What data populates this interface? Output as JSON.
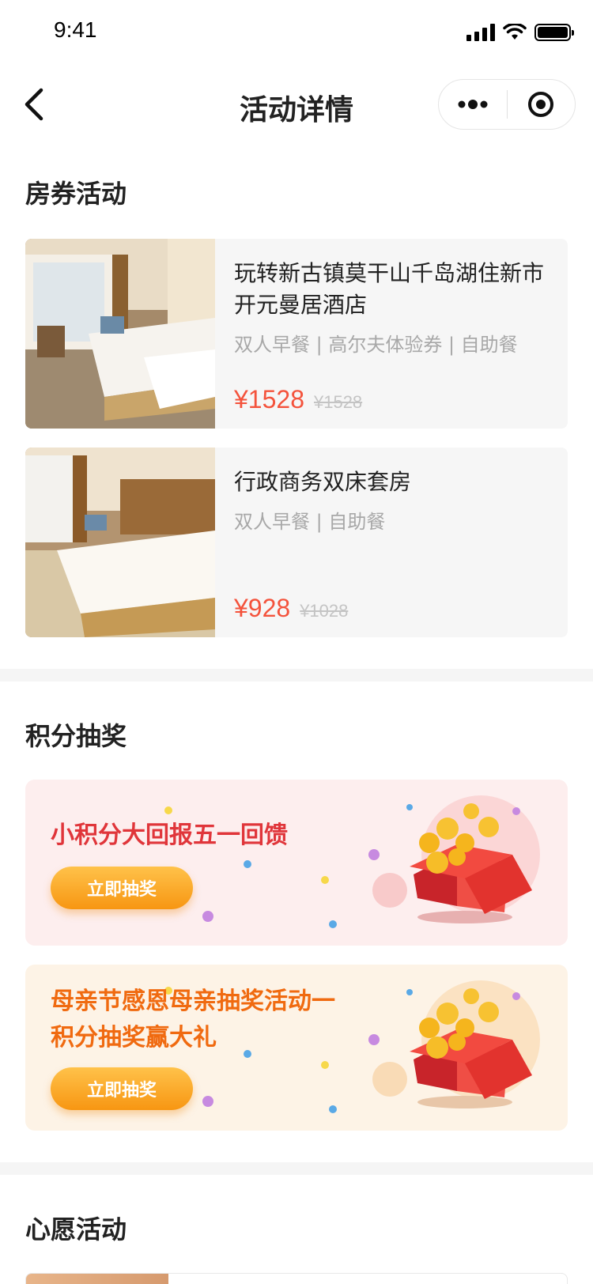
{
  "status_bar": {
    "time": "9:41"
  },
  "nav": {
    "title": "活动详情"
  },
  "sections": {
    "room_title": "房券活动",
    "points_title": "积分抽奖",
    "wish_title": "心愿活动"
  },
  "rooms": [
    {
      "name": "玩转新古镇莫干山千岛湖住新市开元曼居酒店",
      "tags": "双人早餐 | 高尔夫体验券 | 自助餐",
      "price": "¥1528",
      "original_price": "¥1528"
    },
    {
      "name": "行政商务双床套房",
      "tags": "双人早餐 | 自助餐",
      "price": "¥928",
      "original_price": "¥1028"
    }
  ],
  "lotteries": [
    {
      "title": "小积分大回报五一回馈",
      "button": "立即抽奖",
      "title_color": "#e0353a",
      "bg_color": "#fdeeee"
    },
    {
      "title": "母亲节感恩母亲抽奖活动一积分抽奖赢大礼",
      "button": "立即抽奖",
      "title_color": "#f06a10",
      "bg_color": "#fdf3e6"
    }
  ],
  "colors": {
    "price": "#f4533c",
    "button_gradient_top": "#ffc24a",
    "button_gradient_bottom": "#f79612"
  },
  "icons": [
    "back-arrow-icon",
    "more-dots-icon",
    "target-icon",
    "gift-box-icon",
    "signal-icon",
    "wifi-icon",
    "battery-icon"
  ]
}
